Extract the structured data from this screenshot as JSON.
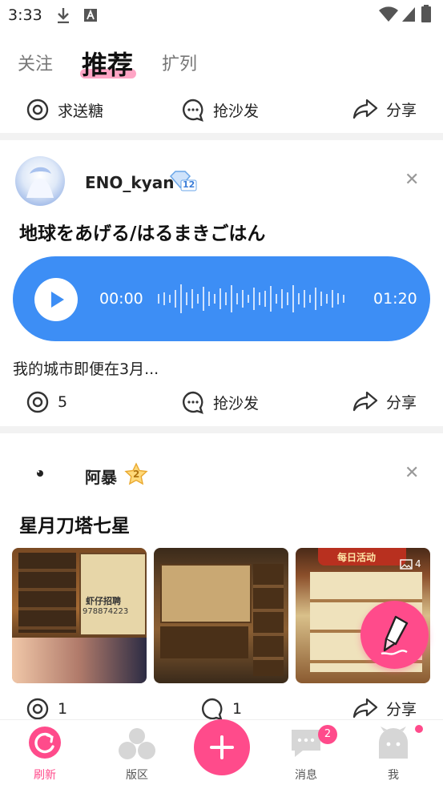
{
  "status_bar": {
    "time": "3:33"
  },
  "tabs": [
    "关注",
    "推荐",
    "扩列"
  ],
  "top_actions": {
    "gift": "求送糖",
    "sofa": "抢沙发",
    "share": "分享"
  },
  "post1": {
    "username": "ENO_kyan",
    "level_badge": "12",
    "title": "地球をあげる/はるまきごはん",
    "audio": {
      "current": "00:00",
      "duration": "01:20"
    },
    "text": "我的城市即便在3月...",
    "comments": "5",
    "sofa": "抢沙发",
    "share": "分享"
  },
  "post2": {
    "username": "阿暴",
    "level_badge": "2",
    "title": "星月刀塔七星",
    "image_count": "4",
    "thumb_text_1": "虾仔招聘",
    "thumb_text_2": "978874223",
    "thumb_text_3": "每日活动",
    "comments": "1",
    "likes": "1",
    "share": "分享"
  },
  "bottom_nav": {
    "refresh": "刷新",
    "sections": "版区",
    "messages": "消息",
    "messages_badge": "2",
    "me": "我"
  },
  "colors": {
    "accent_pink": "#ff4b8b",
    "audio_blue": "#3d8ef5"
  }
}
